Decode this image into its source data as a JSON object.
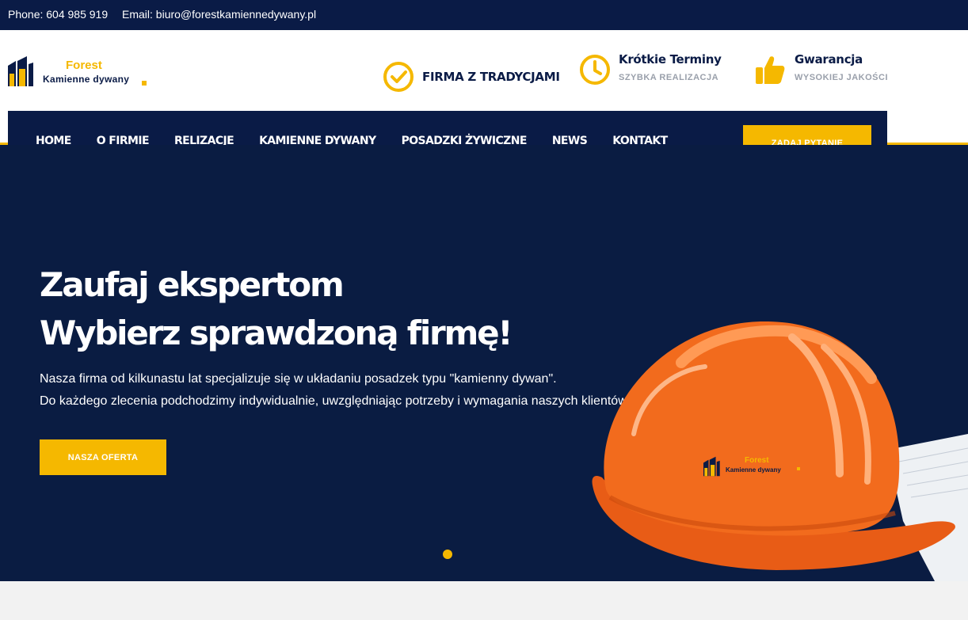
{
  "topbar": {
    "phone": "Phone: 604 985 919",
    "email": "Email: biuro@forestkamiennedywany.pl"
  },
  "logo": {
    "brand": "Forest",
    "subtitle": "Kamienne dywany"
  },
  "features": [
    {
      "title": "FIRMA Z TRADYCJAMI",
      "subtitle": "",
      "icon": "check-circle-icon"
    },
    {
      "title": "Krótkie Terminy",
      "subtitle": "SZYBKA REALIZACJA",
      "icon": "clock-icon"
    },
    {
      "title": "Gwarancja",
      "subtitle": "WYSOKIEJ JAKOŚCI",
      "icon": "thumbs-up-icon"
    }
  ],
  "nav": {
    "items": [
      "HOME",
      "O FIRMIE",
      "RELIZACJE",
      "KAMIENNE DYWANY",
      "POSADZKI ŻYWICZNE",
      "NEWS",
      "KONTAKT"
    ],
    "cta": "ZADAJ PYTANIE"
  },
  "hero": {
    "headline1": "Zaufaj ekspertom",
    "headline2": "Wybierz sprawdzoną firmę!",
    "text1": "Nasza firma od kilkunastu lat specjalizuje się w układaniu posadzek typu \"kamienny dywan\".",
    "text2": "Do każdego zlecenia podchodzimy indywidualnie, uwzględniając potrzeby i wymagania naszych klientów.",
    "button": "NASZA OFERTA",
    "helmet_brand": "Forest",
    "helmet_subtitle": "Kamienne dywany"
  },
  "colors": {
    "navy": "#0a1b46",
    "accent": "#f5b800",
    "helmet": "#f26b1d"
  }
}
